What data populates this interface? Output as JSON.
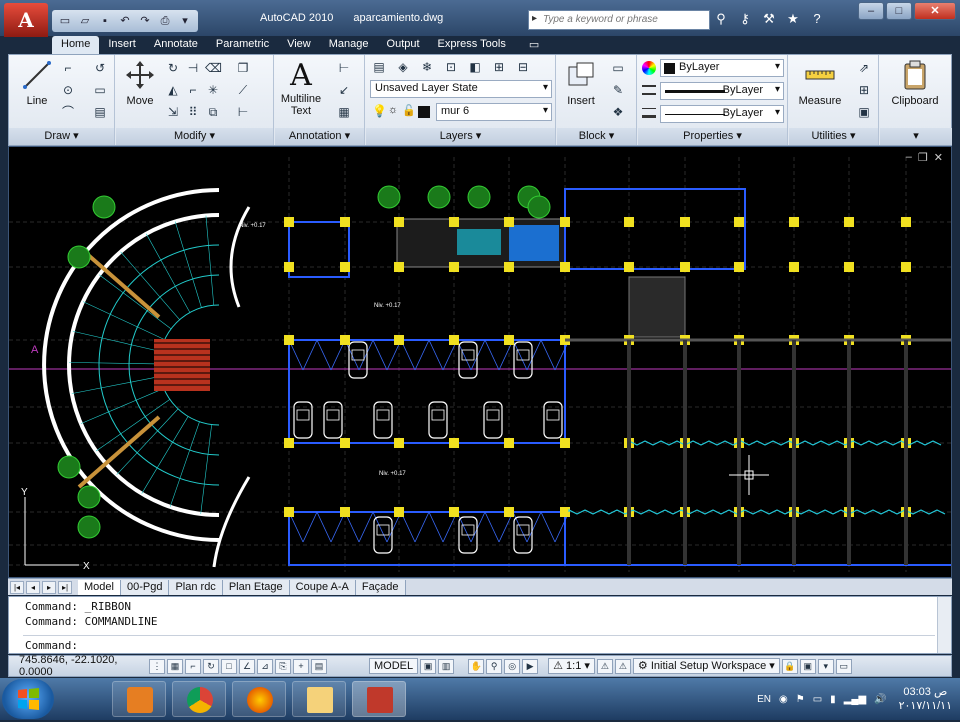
{
  "titlebar": {
    "app": "AutoCAD 2010",
    "file": "aparcamiento.dwg",
    "search_placeholder": "Type a keyword or phrase"
  },
  "ribbon_tabs": [
    "Home",
    "Insert",
    "Annotate",
    "Parametric",
    "View",
    "Manage",
    "Output",
    "Express Tools"
  ],
  "ribbon": {
    "draw": {
      "label": "Draw",
      "line": "Line"
    },
    "modify": {
      "label": "Modify",
      "move": "Move"
    },
    "annotation": {
      "label": "Annotation",
      "text_line1": "Multiline",
      "text_line2": "Text"
    },
    "layers": {
      "label": "Layers",
      "layer_state": "Unsaved Layer State",
      "current_layer": "mur 6"
    },
    "block": {
      "label": "Block",
      "insert": "Insert"
    },
    "properties": {
      "label": "Properties",
      "color": "ByLayer",
      "linetype": "ByLayer",
      "lineweight": "ByLayer"
    },
    "utilities": {
      "label": "Utilities",
      "measure": "Measure"
    },
    "clipboard": {
      "label": "Clipboard"
    }
  },
  "layout_tabs": [
    "Model",
    "00-Pgd",
    "Plan rdc",
    "Plan Etage",
    "Coupe A-A",
    "Façade"
  ],
  "command_lines": [
    "Command: _RIBBON",
    "Command: COMMANDLINE",
    "",
    "Command:"
  ],
  "status": {
    "coords": "745.8646, -22.1020, 0.0000",
    "model": "MODEL",
    "scale": "1:1",
    "workspace": "Initial Setup Workspace"
  },
  "taskbar": {
    "lang": "EN",
    "time": "03:03 ص",
    "date": "٢٠١٧/١١/١١"
  },
  "drawing": {
    "axis_label": "A",
    "level_labels": [
      "Niv. +0.17",
      "Niv. +0.17",
      "Niv. +0.17"
    ]
  }
}
